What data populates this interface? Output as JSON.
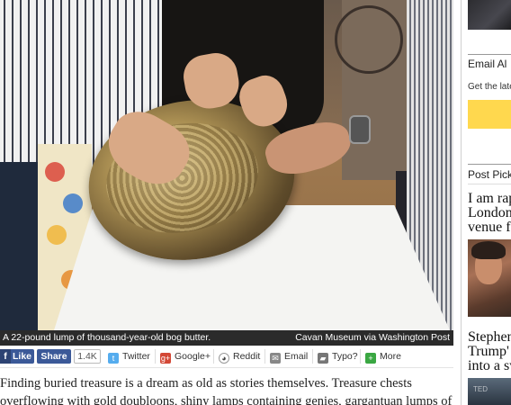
{
  "photo": {
    "caption": "A 22-pound lump of thousand-year-old bog butter.",
    "credit": "Cavan Museum via Washington Post"
  },
  "share": {
    "like_label": "Like",
    "share_label": "Share",
    "count": "1.4K",
    "twitter": "Twitter",
    "googleplus": "Google+",
    "reddit": "Reddit",
    "email": "Email",
    "typo": "Typo?",
    "more": "More"
  },
  "article": {
    "line1": "Finding buried treasure is a dream as old as stories themselves. Treasure chests",
    "line2": "overflowing with gold doubloons, shiny lamps containing genies, gargantuan lumps of"
  },
  "sidebar": {
    "email_heading": "Email Al",
    "email_sub": "Get the late",
    "post_picks": "Post Pick",
    "story1_line1": "I am rap",
    "story1_line2": "London",
    "story1_line3": "venue fo",
    "story2_line1": "Stephen",
    "story2_line2": "Trump'",
    "story2_line3": "into a sv"
  }
}
